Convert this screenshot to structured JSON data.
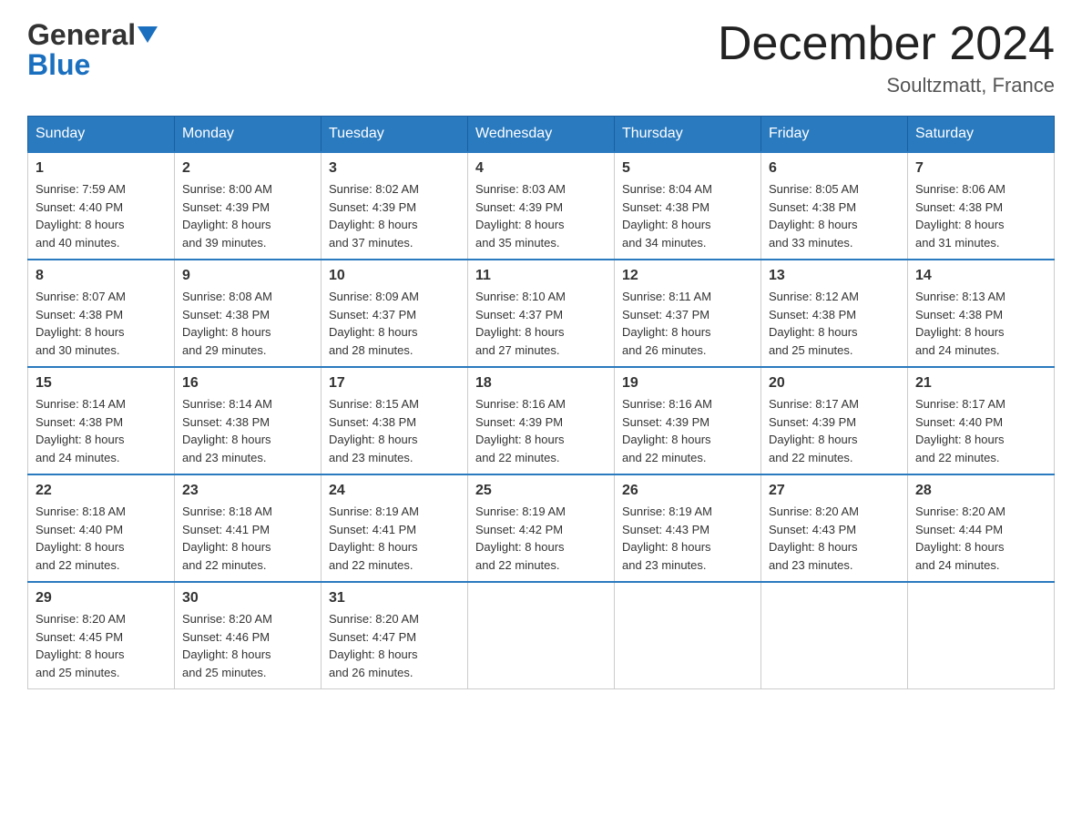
{
  "header": {
    "logo_general": "General",
    "logo_blue": "Blue",
    "title": "December 2024",
    "location": "Soultzmatt, France"
  },
  "weekdays": [
    "Sunday",
    "Monday",
    "Tuesday",
    "Wednesday",
    "Thursday",
    "Friday",
    "Saturday"
  ],
  "weeks": [
    [
      {
        "day": "1",
        "sunrise": "Sunrise: 7:59 AM",
        "sunset": "Sunset: 4:40 PM",
        "daylight": "Daylight: 8 hours",
        "daylight2": "and 40 minutes."
      },
      {
        "day": "2",
        "sunrise": "Sunrise: 8:00 AM",
        "sunset": "Sunset: 4:39 PM",
        "daylight": "Daylight: 8 hours",
        "daylight2": "and 39 minutes."
      },
      {
        "day": "3",
        "sunrise": "Sunrise: 8:02 AM",
        "sunset": "Sunset: 4:39 PM",
        "daylight": "Daylight: 8 hours",
        "daylight2": "and 37 minutes."
      },
      {
        "day": "4",
        "sunrise": "Sunrise: 8:03 AM",
        "sunset": "Sunset: 4:39 PM",
        "daylight": "Daylight: 8 hours",
        "daylight2": "and 35 minutes."
      },
      {
        "day": "5",
        "sunrise": "Sunrise: 8:04 AM",
        "sunset": "Sunset: 4:38 PM",
        "daylight": "Daylight: 8 hours",
        "daylight2": "and 34 minutes."
      },
      {
        "day": "6",
        "sunrise": "Sunrise: 8:05 AM",
        "sunset": "Sunset: 4:38 PM",
        "daylight": "Daylight: 8 hours",
        "daylight2": "and 33 minutes."
      },
      {
        "day": "7",
        "sunrise": "Sunrise: 8:06 AM",
        "sunset": "Sunset: 4:38 PM",
        "daylight": "Daylight: 8 hours",
        "daylight2": "and 31 minutes."
      }
    ],
    [
      {
        "day": "8",
        "sunrise": "Sunrise: 8:07 AM",
        "sunset": "Sunset: 4:38 PM",
        "daylight": "Daylight: 8 hours",
        "daylight2": "and 30 minutes."
      },
      {
        "day": "9",
        "sunrise": "Sunrise: 8:08 AM",
        "sunset": "Sunset: 4:38 PM",
        "daylight": "Daylight: 8 hours",
        "daylight2": "and 29 minutes."
      },
      {
        "day": "10",
        "sunrise": "Sunrise: 8:09 AM",
        "sunset": "Sunset: 4:37 PM",
        "daylight": "Daylight: 8 hours",
        "daylight2": "and 28 minutes."
      },
      {
        "day": "11",
        "sunrise": "Sunrise: 8:10 AM",
        "sunset": "Sunset: 4:37 PM",
        "daylight": "Daylight: 8 hours",
        "daylight2": "and 27 minutes."
      },
      {
        "day": "12",
        "sunrise": "Sunrise: 8:11 AM",
        "sunset": "Sunset: 4:37 PM",
        "daylight": "Daylight: 8 hours",
        "daylight2": "and 26 minutes."
      },
      {
        "day": "13",
        "sunrise": "Sunrise: 8:12 AM",
        "sunset": "Sunset: 4:38 PM",
        "daylight": "Daylight: 8 hours",
        "daylight2": "and 25 minutes."
      },
      {
        "day": "14",
        "sunrise": "Sunrise: 8:13 AM",
        "sunset": "Sunset: 4:38 PM",
        "daylight": "Daylight: 8 hours",
        "daylight2": "and 24 minutes."
      }
    ],
    [
      {
        "day": "15",
        "sunrise": "Sunrise: 8:14 AM",
        "sunset": "Sunset: 4:38 PM",
        "daylight": "Daylight: 8 hours",
        "daylight2": "and 24 minutes."
      },
      {
        "day": "16",
        "sunrise": "Sunrise: 8:14 AM",
        "sunset": "Sunset: 4:38 PM",
        "daylight": "Daylight: 8 hours",
        "daylight2": "and 23 minutes."
      },
      {
        "day": "17",
        "sunrise": "Sunrise: 8:15 AM",
        "sunset": "Sunset: 4:38 PM",
        "daylight": "Daylight: 8 hours",
        "daylight2": "and 23 minutes."
      },
      {
        "day": "18",
        "sunrise": "Sunrise: 8:16 AM",
        "sunset": "Sunset: 4:39 PM",
        "daylight": "Daylight: 8 hours",
        "daylight2": "and 22 minutes."
      },
      {
        "day": "19",
        "sunrise": "Sunrise: 8:16 AM",
        "sunset": "Sunset: 4:39 PM",
        "daylight": "Daylight: 8 hours",
        "daylight2": "and 22 minutes."
      },
      {
        "day": "20",
        "sunrise": "Sunrise: 8:17 AM",
        "sunset": "Sunset: 4:39 PM",
        "daylight": "Daylight: 8 hours",
        "daylight2": "and 22 minutes."
      },
      {
        "day": "21",
        "sunrise": "Sunrise: 8:17 AM",
        "sunset": "Sunset: 4:40 PM",
        "daylight": "Daylight: 8 hours",
        "daylight2": "and 22 minutes."
      }
    ],
    [
      {
        "day": "22",
        "sunrise": "Sunrise: 8:18 AM",
        "sunset": "Sunset: 4:40 PM",
        "daylight": "Daylight: 8 hours",
        "daylight2": "and 22 minutes."
      },
      {
        "day": "23",
        "sunrise": "Sunrise: 8:18 AM",
        "sunset": "Sunset: 4:41 PM",
        "daylight": "Daylight: 8 hours",
        "daylight2": "and 22 minutes."
      },
      {
        "day": "24",
        "sunrise": "Sunrise: 8:19 AM",
        "sunset": "Sunset: 4:41 PM",
        "daylight": "Daylight: 8 hours",
        "daylight2": "and 22 minutes."
      },
      {
        "day": "25",
        "sunrise": "Sunrise: 8:19 AM",
        "sunset": "Sunset: 4:42 PM",
        "daylight": "Daylight: 8 hours",
        "daylight2": "and 22 minutes."
      },
      {
        "day": "26",
        "sunrise": "Sunrise: 8:19 AM",
        "sunset": "Sunset: 4:43 PM",
        "daylight": "Daylight: 8 hours",
        "daylight2": "and 23 minutes."
      },
      {
        "day": "27",
        "sunrise": "Sunrise: 8:20 AM",
        "sunset": "Sunset: 4:43 PM",
        "daylight": "Daylight: 8 hours",
        "daylight2": "and 23 minutes."
      },
      {
        "day": "28",
        "sunrise": "Sunrise: 8:20 AM",
        "sunset": "Sunset: 4:44 PM",
        "daylight": "Daylight: 8 hours",
        "daylight2": "and 24 minutes."
      }
    ],
    [
      {
        "day": "29",
        "sunrise": "Sunrise: 8:20 AM",
        "sunset": "Sunset: 4:45 PM",
        "daylight": "Daylight: 8 hours",
        "daylight2": "and 25 minutes."
      },
      {
        "day": "30",
        "sunrise": "Sunrise: 8:20 AM",
        "sunset": "Sunset: 4:46 PM",
        "daylight": "Daylight: 8 hours",
        "daylight2": "and 25 minutes."
      },
      {
        "day": "31",
        "sunrise": "Sunrise: 8:20 AM",
        "sunset": "Sunset: 4:47 PM",
        "daylight": "Daylight: 8 hours",
        "daylight2": "and 26 minutes."
      },
      null,
      null,
      null,
      null
    ]
  ]
}
